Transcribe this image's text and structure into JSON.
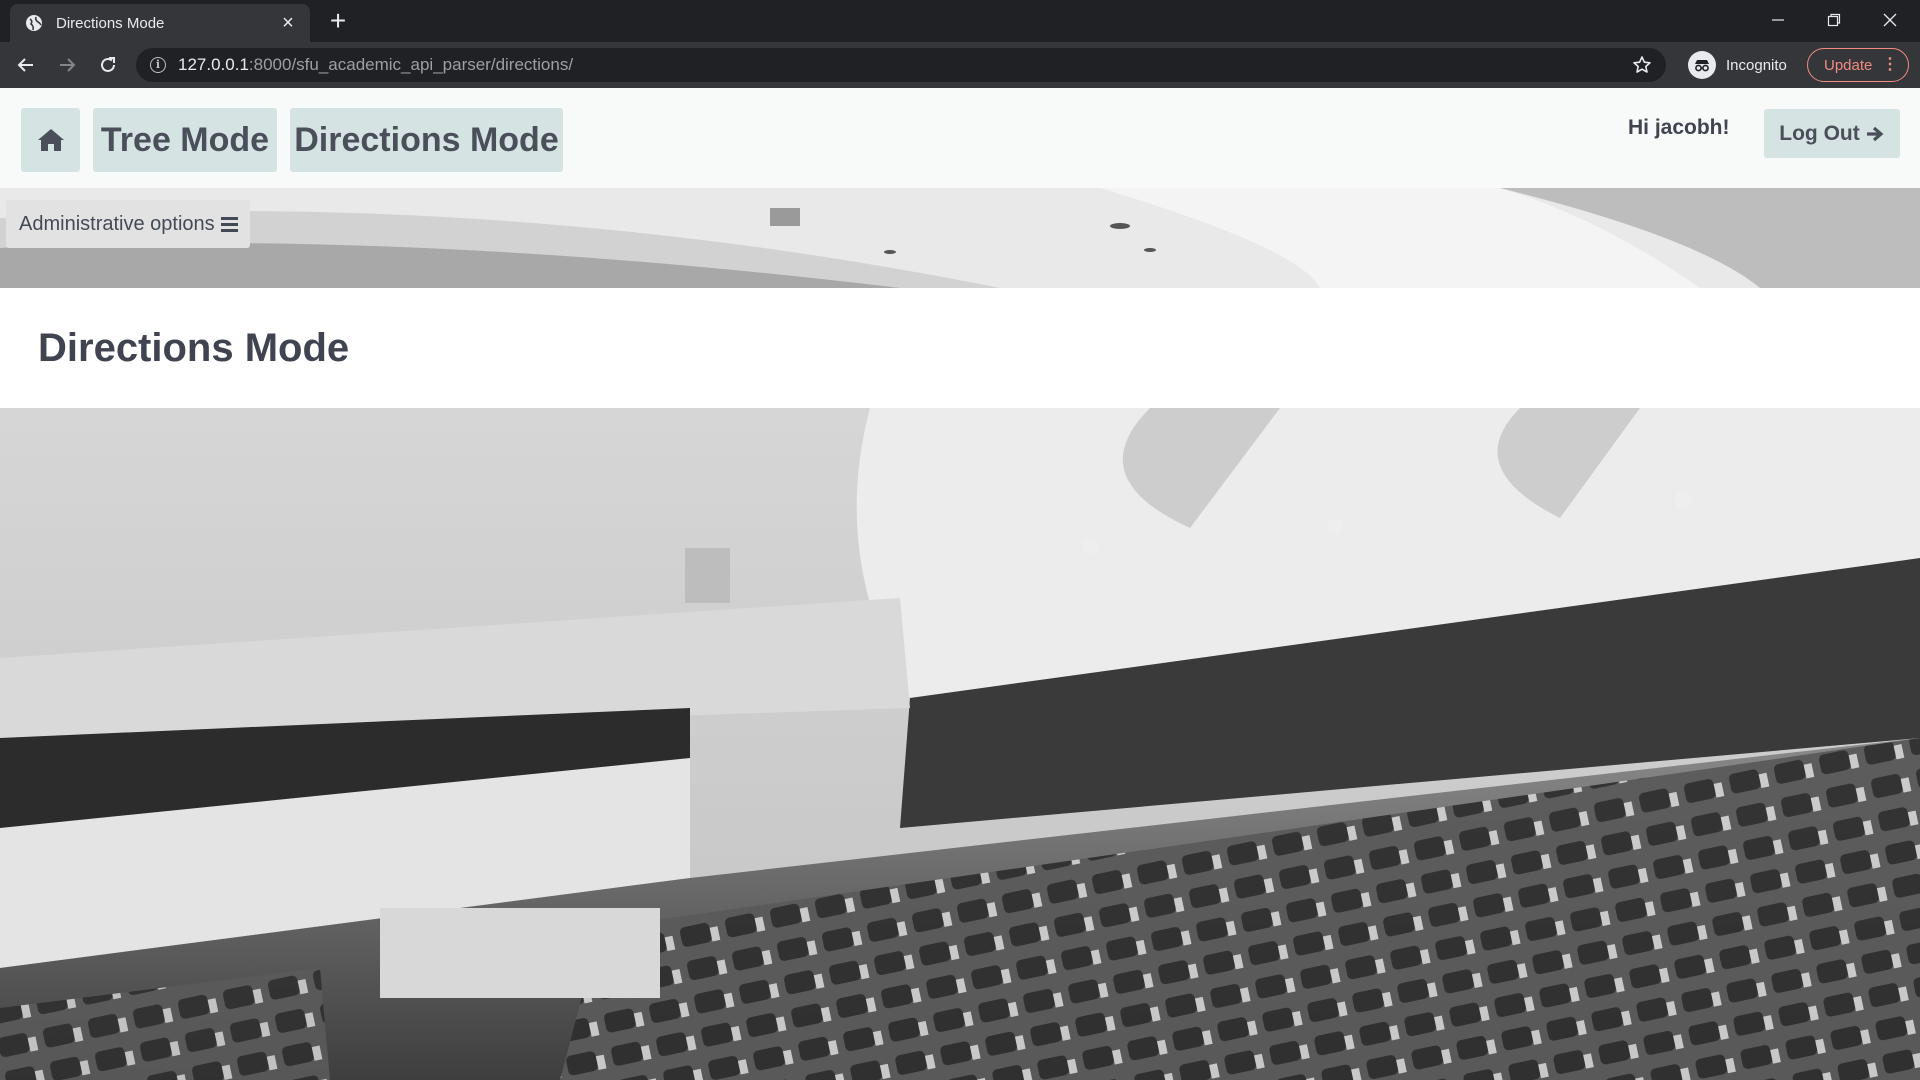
{
  "browser": {
    "tab_title": "Directions Mode",
    "url_host": "127.0.0.1",
    "url_rest": ":8000/sfu_academic_api_parser/directions/",
    "incognito_label": "Incognito",
    "update_label": "Update"
  },
  "navbar": {
    "home_icon": "home-icon",
    "tree_mode": "Tree Mode",
    "directions_mode": "Directions Mode",
    "greeting": "Hi jacobh!",
    "logout": "Log Out"
  },
  "admin": {
    "label": "Administrative options"
  },
  "main": {
    "title": "Directions Mode"
  },
  "colors": {
    "nav_button_bg": "#d5e4e2",
    "heading_text": "#3f4450",
    "chrome_dark": "#202124",
    "update_accent": "#f28b82"
  }
}
